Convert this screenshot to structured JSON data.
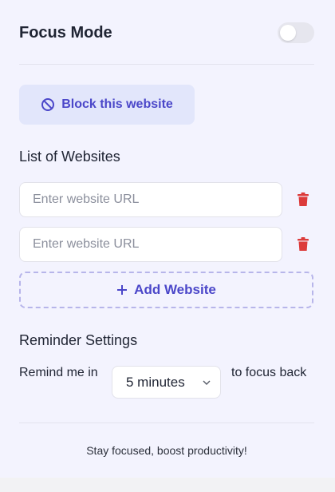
{
  "header": {
    "title": "Focus Mode",
    "toggle_on": false
  },
  "block_button": {
    "label": "Block this website",
    "icon": "ban-icon"
  },
  "websites": {
    "title": "List of Websites",
    "items": [
      {
        "placeholder": "Enter website URL",
        "value": ""
      },
      {
        "placeholder": "Enter website URL",
        "value": ""
      }
    ],
    "delete_icon": "trash-icon",
    "add_label": "Add Website"
  },
  "reminder": {
    "title": "Reminder Settings",
    "prefix": "Remind me in",
    "selected": "5 minutes",
    "suffix": "to focus back"
  },
  "footer": {
    "text": "Stay focused, boost productivity!"
  },
  "colors": {
    "accent": "#4b47c9",
    "accent_bg": "#e2e6fb",
    "danger": "#dc3b3b",
    "background": "#f3f3fe"
  }
}
